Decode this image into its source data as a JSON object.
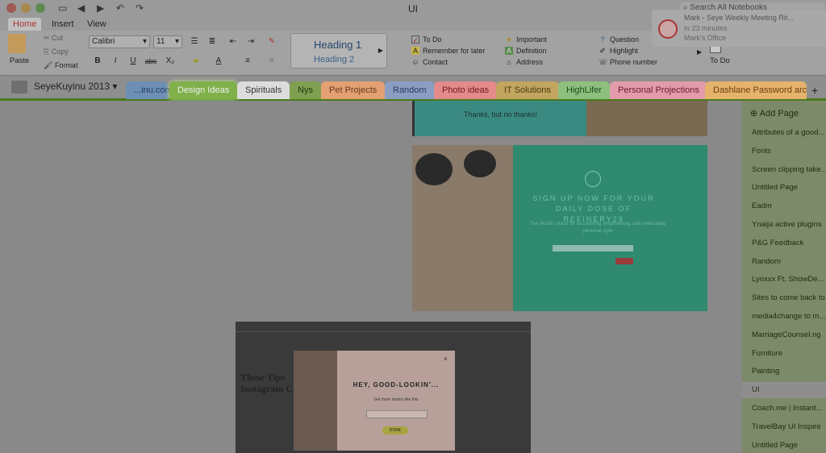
{
  "window": {
    "title": "UI",
    "search_placeholder": "Search All Notebooks"
  },
  "ribbon_tabs": [
    "Home",
    "Insert",
    "View"
  ],
  "clipboard": {
    "paste": "Paste",
    "cut": "Cut",
    "copy": "Copy",
    "format": "Format"
  },
  "font": {
    "family": "Calibri",
    "size": "11"
  },
  "format_buttons": [
    "B",
    "I",
    "U",
    "abc",
    "X₂"
  ],
  "styles": {
    "h1": "Heading 1",
    "h2": "Heading 2"
  },
  "tags": [
    {
      "label": "To Do",
      "icon": "checkbox-icon"
    },
    {
      "label": "Remember for later",
      "icon": "letter-a-icon"
    },
    {
      "label": "Contact",
      "icon": "contact-icon"
    },
    {
      "label": "Important",
      "icon": "star-icon"
    },
    {
      "label": "Definition",
      "icon": "letter-a-green-icon"
    },
    {
      "label": "Address",
      "icon": "house-icon"
    },
    {
      "label": "Question",
      "icon": "question-icon"
    },
    {
      "label": "Highlight",
      "icon": "highlighter-icon"
    },
    {
      "label": "Phone number",
      "icon": "phone-icon"
    }
  ],
  "todo_label": "To Do",
  "notebook": {
    "name": "SeyeKuyinu 2013"
  },
  "sections": [
    {
      "label": "...inu.com",
      "color": "#6d8fb5"
    },
    {
      "label": "Design Ideas",
      "color": "#7fb04a"
    },
    {
      "label": "Spirituals",
      "color": "#dcdcdc"
    },
    {
      "label": "Nys",
      "color": "#7fa050"
    },
    {
      "label": "Pet Projects",
      "color": "#e3a073"
    },
    {
      "label": "Random",
      "color": "#8a9ec4"
    },
    {
      "label": "Photo ideas",
      "color": "#e58a8a"
    },
    {
      "label": "IT Solutions",
      "color": "#c2a55e"
    },
    {
      "label": "HighLifer",
      "color": "#8dc07e"
    },
    {
      "label": "Personal Projections",
      "color": "#e39bac"
    },
    {
      "label": "Dashlane Password archi",
      "color": "#e5b36b"
    }
  ],
  "add_page": "Add Page",
  "pages": [
    "Attributes of a good...",
    "Fonts",
    "Screen clipping take...",
    "Untitled Page",
    "Eadm",
    "Ynaija active plugins",
    "P&G Feedback",
    "Random",
    "Lynxxx Ft. ShowDe...",
    "Sites to come back to",
    "media4change to m...",
    "MarriageCounsel.ng",
    "Furniture",
    "Painting",
    "UI",
    "Coach.me | Instant...",
    "TravelBay UI Inspire",
    "Untitled Page"
  ],
  "notification": {
    "title": "Mark - Seye Weekly Meeting Rit...",
    "line2": "in 23 minutes",
    "line3": "Mark's Office"
  },
  "content": {
    "banner_text": "Thanks, but no thanks!",
    "promo_title": "SIGN UP NOW FOR YOUR DAILY DOSE OF REFINERY29",
    "promo_sub": "The World's place for discovering, empowering, and celebrating personal style",
    "popup_title": "HEY, GOOD-LOOKIN'...",
    "popup_sub": "Get more stories like this",
    "popup_btn": "DONE",
    "article_title": "These Tips Instagram C"
  },
  "colors": {
    "accent": "#4a7a1c",
    "promo": "#3aa889"
  }
}
